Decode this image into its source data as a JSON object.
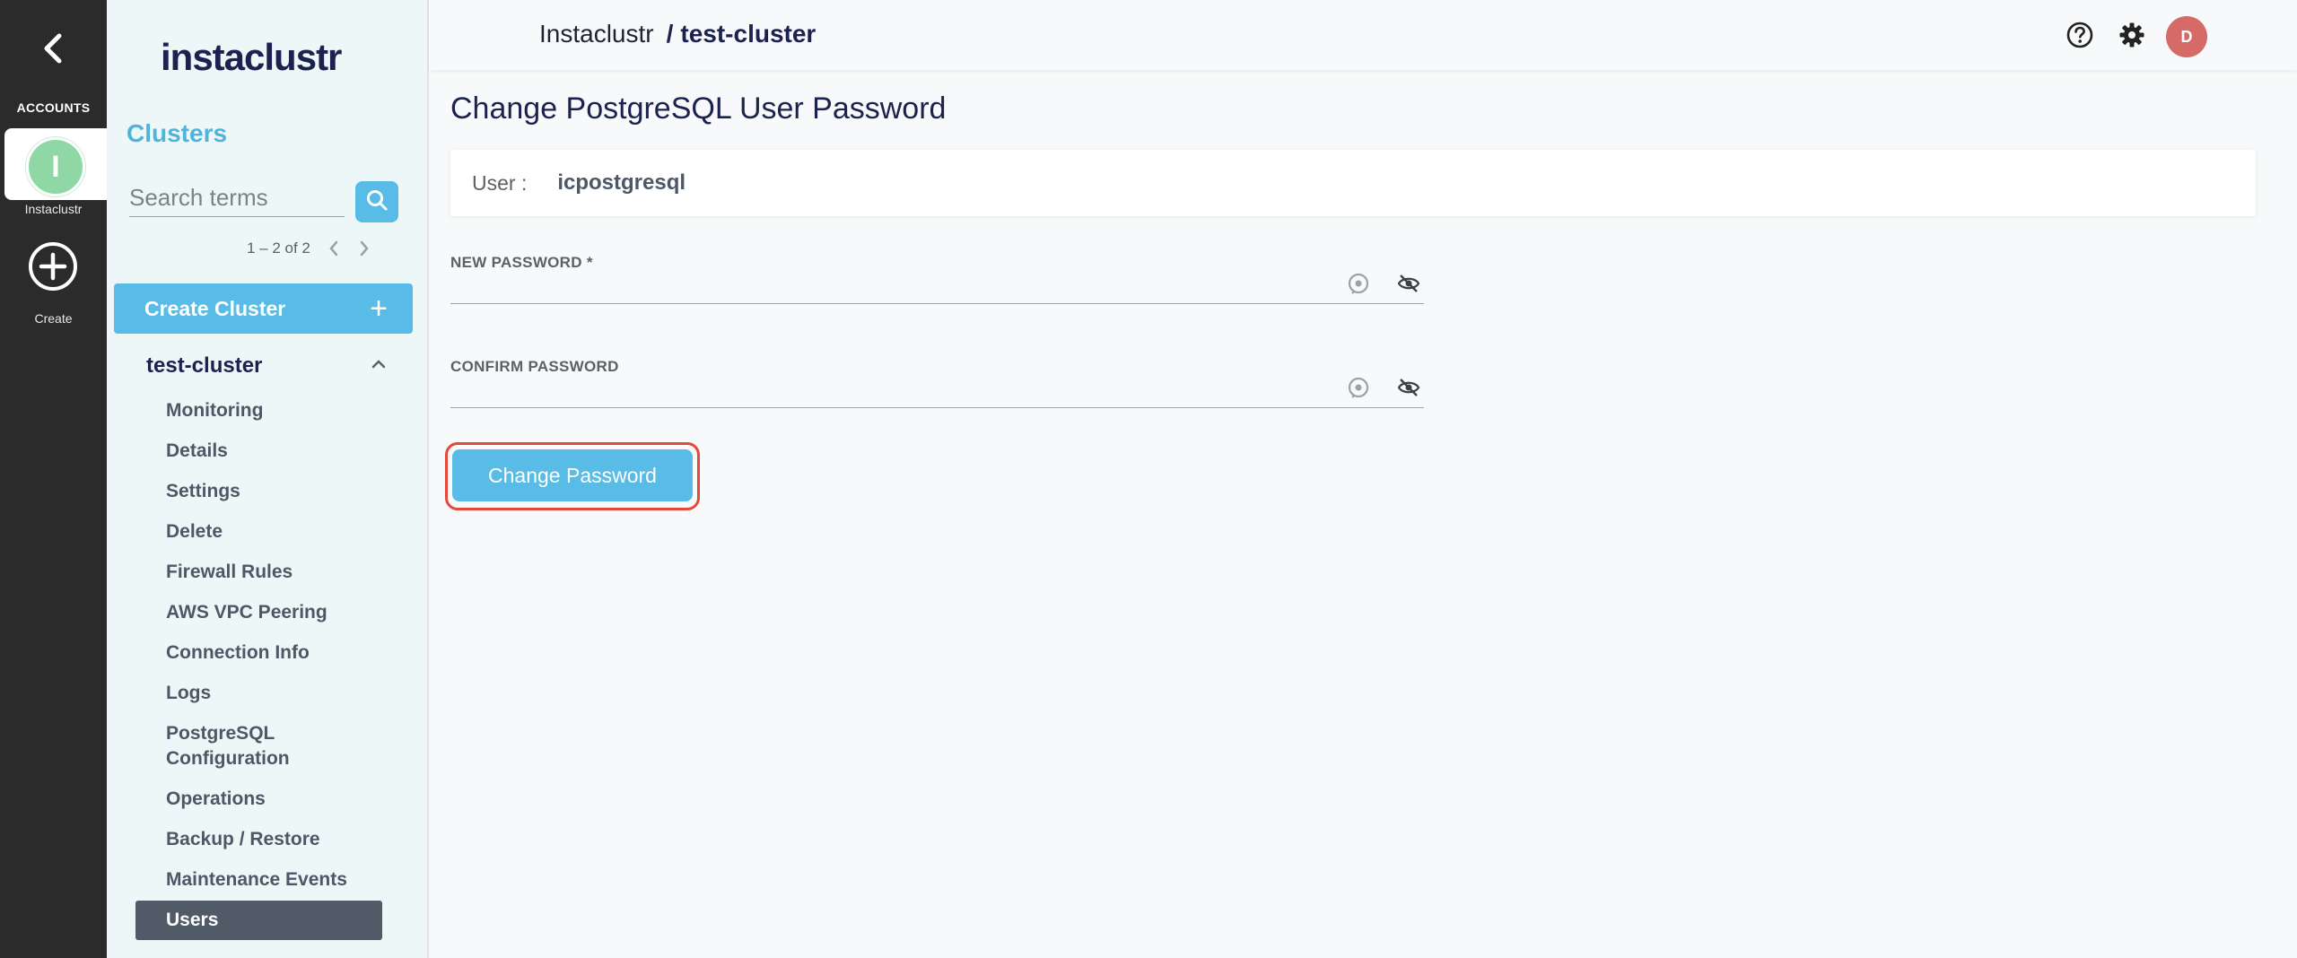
{
  "rail": {
    "accounts_label": "ACCOUNTS",
    "account_initial": "I",
    "account_name": "Instaclustr",
    "create_label": "Create"
  },
  "sidebar": {
    "logo": "instaclustr",
    "title": "Clusters",
    "search_placeholder": "Search terms",
    "pager_text": "1 – 2 of 2",
    "create_cluster_label": "Create Cluster",
    "cluster_name": "test-cluster",
    "menu": [
      "Monitoring",
      "Details",
      "Settings",
      "Delete",
      "Firewall Rules",
      "AWS VPC Peering",
      "Connection Info",
      "Logs",
      "PostgreSQL Configuration",
      "Operations",
      "Backup / Restore",
      "Maintenance Events",
      "Users"
    ],
    "active_menu": "Users"
  },
  "header": {
    "breadcrumb_root": "Instaclustr",
    "breadcrumb_sep": "/",
    "breadcrumb_current": "test-cluster",
    "user_initial": "D"
  },
  "main": {
    "title": "Change PostgreSQL User Password",
    "user_key": "User :",
    "user_value": "icpostgresql",
    "new_password_label": "NEW PASSWORD *",
    "confirm_password_label": "CONFIRM PASSWORD",
    "new_password_value": "",
    "confirm_password_value": "",
    "submit_label": "Change Password"
  },
  "colors": {
    "accent": "#58bce6",
    "rail": "#2b2b2b",
    "highlight_outline": "#e24a3b",
    "avatar_user": "#d66a66",
    "avatar_account": "#8fd7a5"
  }
}
